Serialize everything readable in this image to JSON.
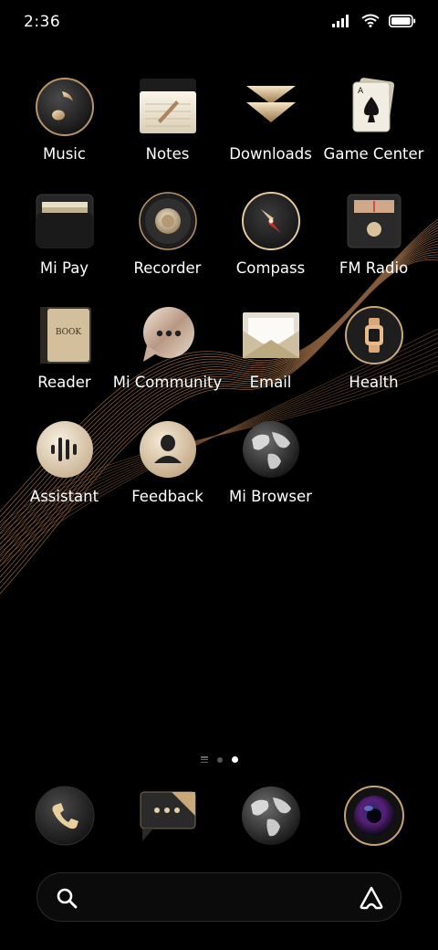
{
  "status_bar": {
    "time": "2:36"
  },
  "apps": [
    [
      {
        "label": "Music",
        "icon": "music-icon"
      },
      {
        "label": "Notes",
        "icon": "notes-icon"
      },
      {
        "label": "Downloads",
        "icon": "downloads-icon"
      },
      {
        "label": "Game Center",
        "icon": "game-center-icon"
      }
    ],
    [
      {
        "label": "Mi Pay",
        "icon": "wallet-icon"
      },
      {
        "label": "Recorder",
        "icon": "recorder-icon"
      },
      {
        "label": "Compass",
        "icon": "compass-icon"
      },
      {
        "label": "FM Radio",
        "icon": "radio-icon"
      }
    ],
    [
      {
        "label": "Reader",
        "icon": "book-icon",
        "icon_text": "BOOK"
      },
      {
        "label": "Mi Community",
        "icon": "chat-bubble-icon"
      },
      {
        "label": "Email",
        "icon": "envelope-icon"
      },
      {
        "label": "Health",
        "icon": "watch-icon"
      }
    ],
    [
      {
        "label": "Assistant",
        "icon": "voice-wave-icon"
      },
      {
        "label": "Feedback",
        "icon": "person-icon"
      },
      {
        "label": "Mi Browser",
        "icon": "globe-icon"
      }
    ]
  ],
  "page_indicator": {
    "pages": 2,
    "active_page": 2,
    "has_feed_page": true
  },
  "dock": [
    {
      "name": "phone",
      "icon": "phone-icon"
    },
    {
      "name": "messages",
      "icon": "message-icon"
    },
    {
      "name": "browser",
      "icon": "globe-icon"
    },
    {
      "name": "camera",
      "icon": "camera-icon"
    }
  ],
  "search_bar": {
    "search_icon": "search-icon",
    "assistant_icon": "assistant-icon"
  },
  "colors": {
    "background": "#000000",
    "gold": "#d9b98a",
    "bronze": "#b07a4f"
  }
}
